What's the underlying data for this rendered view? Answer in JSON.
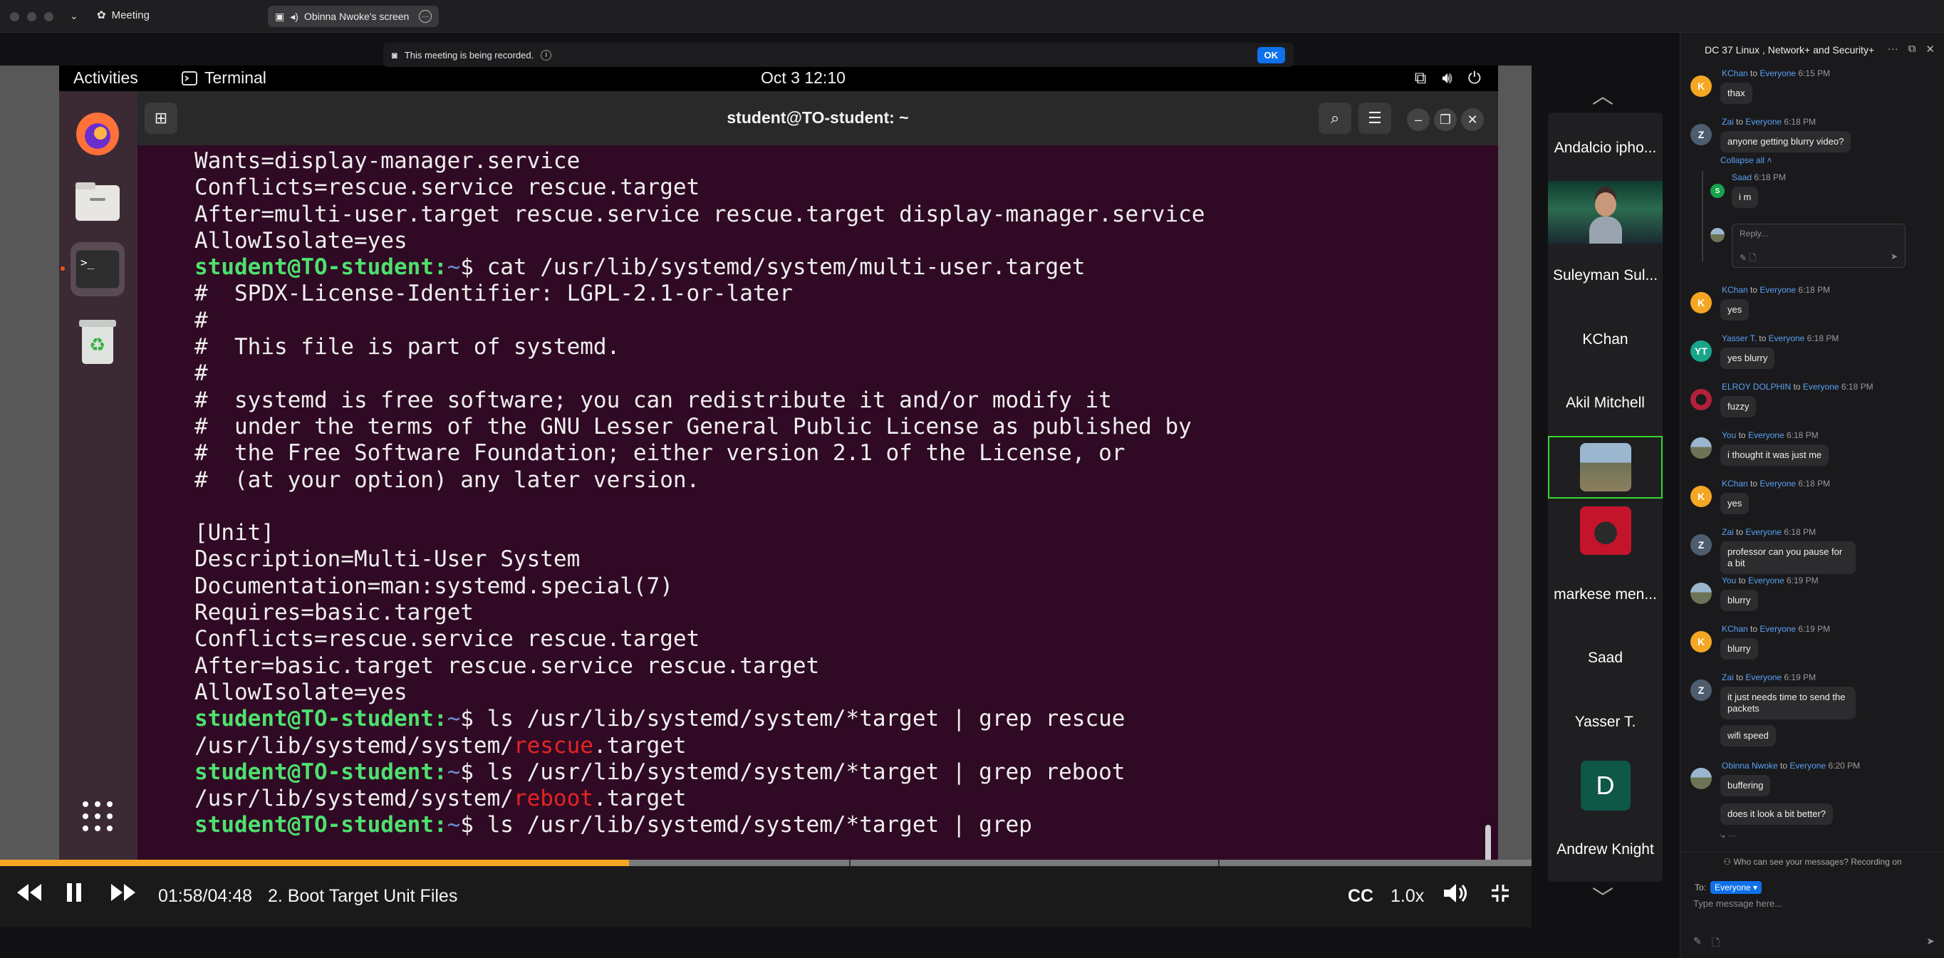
{
  "window": {
    "app_name": "Meeting",
    "tab_label": "Obinna Nwoke's screen"
  },
  "banner": {
    "text": "This meeting is being recorded.",
    "ok_label": "OK"
  },
  "ubuntu": {
    "activities": "Activities",
    "app": "Terminal",
    "clock": "Oct 3  12:10",
    "terminal_title": "student@TO-student: ~"
  },
  "terminal": {
    "lines": [
      "Wants=display-manager.service",
      "Conflicts=rescue.service rescue.target",
      "After=multi-user.target rescue.service rescue.target display-manager.service",
      "AllowIsolate=yes",
      {
        "prompt": "student@TO-student:",
        "path": "~",
        "cmd": "$ cat /usr/lib/systemd/system/multi-user.target"
      },
      "#  SPDX-License-Identifier: LGPL-2.1-or-later",
      "#",
      "#  This file is part of systemd.",
      "#",
      "#  systemd is free software; you can redistribute it and/or modify it",
      "#  under the terms of the GNU Lesser General Public License as published by",
      "#  the Free Software Foundation; either version 2.1 of the License, or",
      "#  (at your option) any later version.",
      "",
      "[Unit]",
      "Description=Multi-User System",
      "Documentation=man:systemd.special(7)",
      "Requires=basic.target",
      "Conflicts=rescue.service rescue.target",
      "After=basic.target rescue.service rescue.target",
      "AllowIsolate=yes",
      {
        "prompt": "student@TO-student:",
        "path": "~",
        "cmd": "$ ls /usr/lib/systemd/system/*target | grep rescue"
      },
      {
        "pre": "/usr/lib/systemd/system/",
        "hl": "rescue",
        "post": ".target"
      },
      {
        "prompt": "student@TO-student:",
        "path": "~",
        "cmd": "$ ls /usr/lib/systemd/system/*target | grep reboot"
      },
      {
        "pre": "/usr/lib/systemd/system/",
        "hl": "reboot",
        "post": ".target"
      },
      {
        "prompt": "student@TO-student:",
        "path": "~",
        "cmd": "$ ls /usr/lib/systemd/system/*target | grep "
      }
    ]
  },
  "player": {
    "time": "01:58/04:48",
    "chapter": "2. Boot Target Unit Files",
    "cc": "CC",
    "speed": "1.0x",
    "progress_fraction": 0.4107
  },
  "gallery": {
    "tiles": [
      {
        "name": "Andalcio ipho...",
        "kind": "name"
      },
      {
        "name": "",
        "kind": "avatar-image"
      },
      {
        "name": "Suleyman Sul...",
        "kind": "name"
      },
      {
        "name": "KChan",
        "kind": "name"
      },
      {
        "name": "Akil Mitchell",
        "kind": "name"
      },
      {
        "name": "",
        "kind": "active-image"
      },
      {
        "name": "",
        "kind": "red-image"
      },
      {
        "name": "markese men...",
        "kind": "name"
      },
      {
        "name": "Saad",
        "kind": "name"
      },
      {
        "name": "Yasser T.",
        "kind": "name"
      },
      {
        "name": "D",
        "kind": "letter"
      },
      {
        "name": "Andrew Knight",
        "kind": "name"
      }
    ]
  },
  "chat": {
    "title": "DC 37 Linux , Network+ and Security+",
    "collapse_label": "Collapse all",
    "reply_placeholder": "Reply...",
    "messages": [
      {
        "sender": "KChan",
        "to": "to",
        "rcpt": "Everyone",
        "time": "6:15 PM",
        "avatar": "K",
        "color": "#f5a623",
        "bubbles": [
          "thax"
        ]
      },
      {
        "sender": "Zai",
        "to": "to",
        "rcpt": "Everyone",
        "time": "6:18 PM",
        "avatar": "Z",
        "color": "#4e5d6e",
        "bubbles": [
          "anyone getting blurry video?"
        ]
      },
      {
        "sender": "KChan",
        "to": "to",
        "rcpt": "Everyone",
        "time": "6:18 PM",
        "avatar": "K",
        "color": "#f5a623",
        "bubbles": [
          "yes"
        ]
      },
      {
        "sender": "Yasser T.",
        "to": "to",
        "rcpt": "Everyone",
        "time": "6:18 PM",
        "avatar": "YT",
        "color": "#18a58a",
        "bubbles": [
          "yes blurry"
        ]
      },
      {
        "sender": "ELROY DOLPHIN",
        "to": "to",
        "rcpt": "Everyone",
        "time": "6:18 PM",
        "avatar": "",
        "color": "#b2203a",
        "bubbles": [
          "fuzzy"
        ]
      },
      {
        "sender": "You",
        "to": "to",
        "rcpt": "Everyone",
        "time": "6:18 PM",
        "avatar": "",
        "color": "#6d8299",
        "bubbles": [
          "i thought it was just me"
        ]
      },
      {
        "sender": "KChan",
        "to": "to",
        "rcpt": "Everyone",
        "time": "6:18 PM",
        "avatar": "K",
        "color": "#f5a623",
        "bubbles": [
          "yes"
        ]
      },
      {
        "sender": "Zai",
        "to": "to",
        "rcpt": "Everyone",
        "time": "6:18 PM",
        "avatar": "Z",
        "color": "#4e5d6e",
        "bubbles": [
          "professor can you pause for a bit"
        ]
      },
      {
        "sender": "You",
        "to": "to",
        "rcpt": "Everyone",
        "time": "6:19 PM",
        "avatar": "",
        "color": "#6d8299",
        "bubbles": [
          "blurry"
        ]
      },
      {
        "sender": "KChan",
        "to": "to",
        "rcpt": "Everyone",
        "time": "6:19 PM",
        "avatar": "K",
        "color": "#f5a623",
        "bubbles": [
          "blurry"
        ]
      },
      {
        "sender": "Zai",
        "to": "to",
        "rcpt": "Everyone",
        "time": "6:19 PM",
        "avatar": "Z",
        "color": "#4e5d6e",
        "bubbles": [
          "it just needs time to send the packets",
          "wifi speed"
        ]
      },
      {
        "sender": "Obinna Nwoke",
        "to": "to",
        "rcpt": "Everyone",
        "time": "6:20 PM",
        "avatar": "",
        "color": "#7a8a7a",
        "bubbles": [
          "buffering",
          "does it look a bit better?"
        ]
      }
    ],
    "thread_reply": {
      "sender": "Saad",
      "time": "6:18 PM",
      "avatar": "S",
      "text": "i m"
    },
    "who_can_see": "Who can see your messages? Recording on",
    "to_label": "To:",
    "to_value": "Everyone",
    "input_placeholder": "Type message here..."
  }
}
